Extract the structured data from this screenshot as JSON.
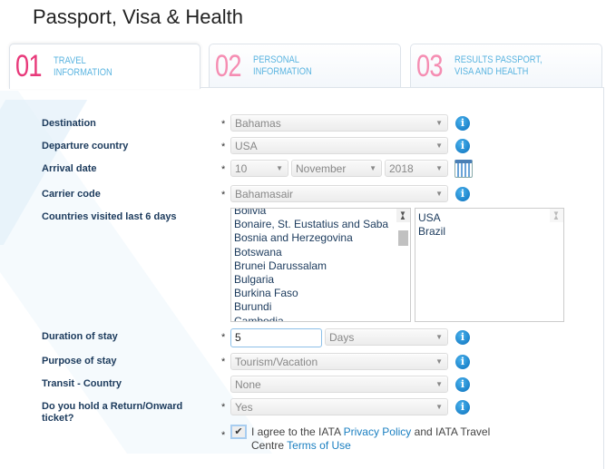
{
  "page_title": "Passport, Visa & Health",
  "tabs": [
    {
      "num": "01",
      "label": "Travel Information",
      "line1": "TRAVEL",
      "line2": "INFORMATION"
    },
    {
      "num": "02",
      "label": "Personal Information",
      "line1": "PERSONAL",
      "line2": "INFORMATION"
    },
    {
      "num": "03",
      "label": "Results Passport, Visa and Health",
      "line1": "RESULTS PASSPORT,",
      "line2": "VISA AND HEALTH"
    }
  ],
  "form": {
    "destination": {
      "label": "Destination",
      "value": "Bahamas"
    },
    "departure": {
      "label": "Departure country",
      "value": "USA"
    },
    "arrival": {
      "label": "Arrival date",
      "day": "10",
      "month": "November",
      "year": "2018"
    },
    "carrier": {
      "label": "Carrier code",
      "value": "Bahamasair"
    },
    "countries": {
      "label": "Countries visited last 6 days",
      "options": [
        "Bolivia",
        "Bonaire, St. Eustatius and Saba",
        "Bosnia and Herzegovina",
        "Botswana",
        "Brunei Darussalam",
        "Bulgaria",
        "Burkina Faso",
        "Burundi",
        "Cambodia"
      ],
      "selected": [
        "USA",
        "Brazil"
      ]
    },
    "duration": {
      "label": "Duration of stay",
      "value": "5",
      "unit": "Days"
    },
    "purpose": {
      "label": "Purpose of stay",
      "value": "Tourism/Vacation"
    },
    "transit": {
      "label": "Transit - Country",
      "value": "None"
    },
    "return": {
      "label": "Do you hold a Return/Onward ticket?",
      "value": "Yes"
    },
    "agree": {
      "checked": true,
      "t1": "I agree to the IATA ",
      "link1": "Privacy Policy",
      "t2": " and IATA Travel Centre ",
      "link2": "Terms of Use"
    }
  },
  "star": "*",
  "arrow": "▼",
  "info": "i"
}
